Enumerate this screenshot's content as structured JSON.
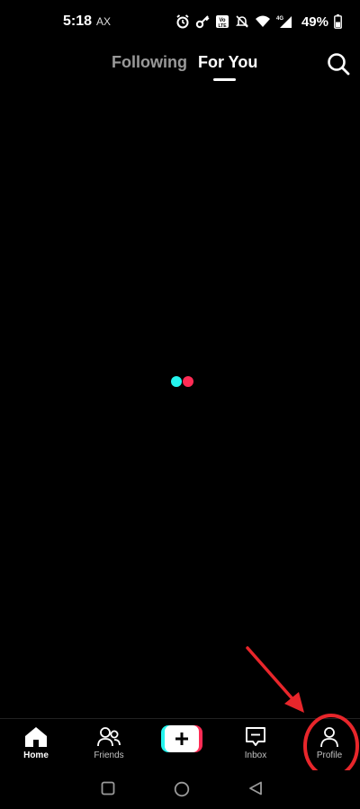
{
  "status_bar": {
    "time": "5:18",
    "carrier": "AX",
    "battery_percent": "49%",
    "icons": [
      "alarm-icon",
      "key-icon",
      "volte-icon",
      "mute-icon",
      "wifi-icon",
      "signal-4g-icon",
      "battery-icon"
    ]
  },
  "top_tabs": {
    "following": "Following",
    "for_you": "For You",
    "active": "For You"
  },
  "colors": {
    "background": "#000000",
    "accent_cyan": "#25f4ee",
    "accent_red": "#fe2c55",
    "annotation_red": "#e8262b"
  },
  "bottom_nav": {
    "home": "Home",
    "friends": "Friends",
    "inbox": "Inbox",
    "profile": "Profile",
    "active": "Home"
  }
}
